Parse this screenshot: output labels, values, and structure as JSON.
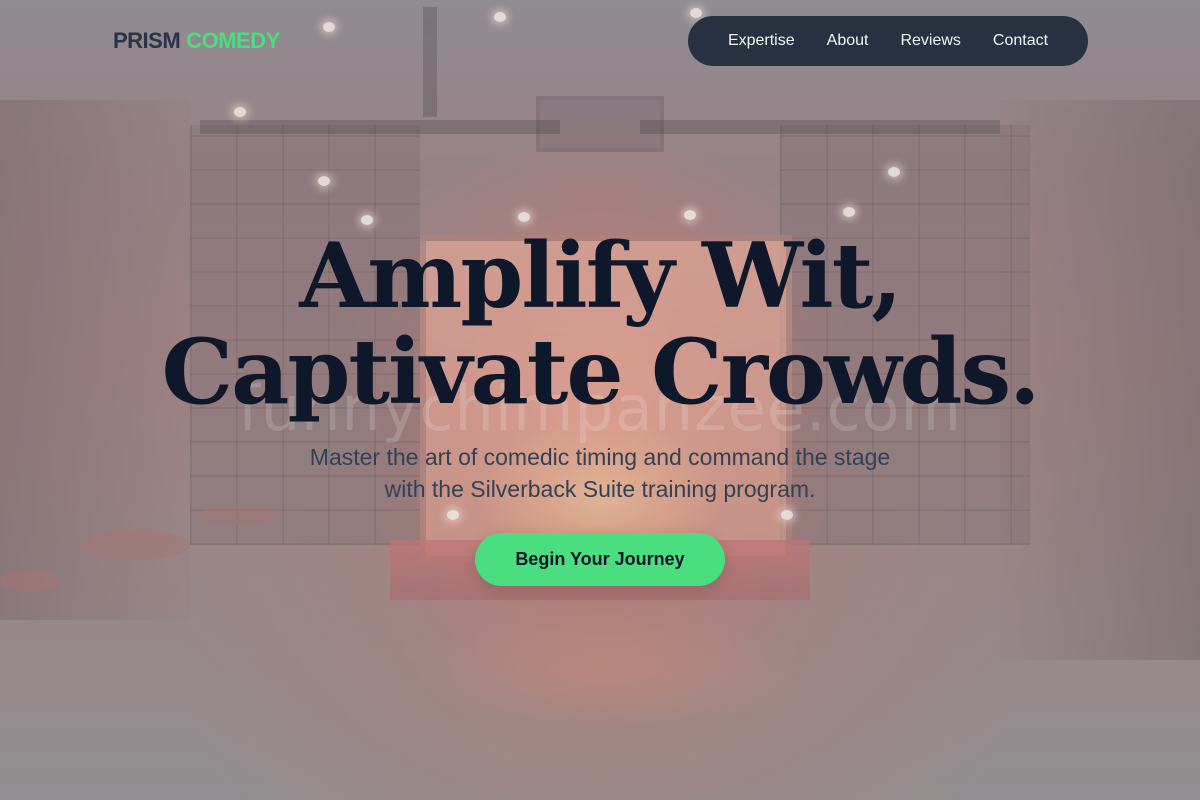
{
  "brand": {
    "word1": "PRISM",
    "word2": "COMEDY"
  },
  "nav": {
    "items": [
      {
        "label": "Expertise"
      },
      {
        "label": "About"
      },
      {
        "label": "Reviews"
      },
      {
        "label": "Contact"
      }
    ]
  },
  "hero": {
    "headline_line1": "Amplify Wit,",
    "headline_line2": "Captivate Crowds.",
    "subtitle_line1": "Master the art of comedic timing and command the stage",
    "subtitle_line2": "with the Silverback Suite training program.",
    "cta_label": "Begin Your Journey",
    "watermark": "funnychimpanzee.com"
  },
  "colors": {
    "accent": "#4ade80",
    "nav_background": "#1e293b",
    "heading": "#0f172a",
    "body_text": "#334155"
  }
}
